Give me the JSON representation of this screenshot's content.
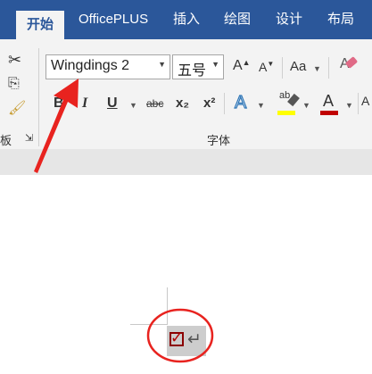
{
  "tabs": [
    {
      "label": "开始",
      "active": true
    },
    {
      "label": "OfficePLUS",
      "active": false
    },
    {
      "label": "插入",
      "active": false
    },
    {
      "label": "绘图",
      "active": false
    },
    {
      "label": "设计",
      "active": false
    },
    {
      "label": "布局",
      "active": false
    }
  ],
  "font_group": {
    "font_name": "Wingdings 2",
    "font_size": "五号",
    "grow_font": "A",
    "shrink_font": "A",
    "change_case": "Aa",
    "bold": "B",
    "italic": "I",
    "underline": "U",
    "strikethrough": "abc",
    "subscript": "x₂",
    "superscript": "x²",
    "text_effects": "A",
    "highlight": "ab",
    "font_color": "A",
    "label": "字体"
  },
  "clipboard_group": {
    "label": "板"
  },
  "document": {
    "checkbox_char": "☑",
    "paragraph_mark": "↵"
  },
  "colors": {
    "ribbon_blue": "#2b579a",
    "annotation_red": "#e8231f",
    "highlight_yellow": "#ffff00",
    "font_red": "#c00000"
  }
}
